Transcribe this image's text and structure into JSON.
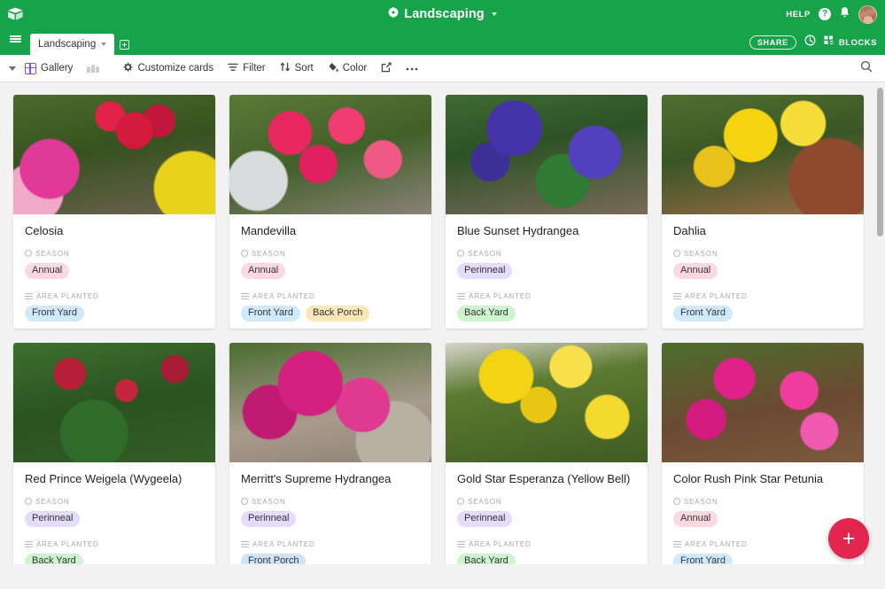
{
  "header": {
    "logo_icon": "airtable-cube-logo",
    "base_flower_icon": "flower-icon",
    "base_name": "Landscaping",
    "help_label": "HELP",
    "help_icon": "question-circle-icon",
    "notifications_icon": "bell-icon",
    "avatar_icon": "user-avatar"
  },
  "tabbar": {
    "menu_icon": "hamburger-menu-icon",
    "active_tab": "Landscaping",
    "add_tab_icon": "plus-box-icon",
    "share_label": "SHARE",
    "history_icon": "history-clock-icon",
    "blocks_icon": "blocks-icon",
    "blocks_label": "BLOCKS"
  },
  "toolbar": {
    "view_caret_icon": "caret-down-icon",
    "view_icon": "gallery-grid-icon",
    "view_name": "Gallery",
    "collaborators_icon": "collaborators-icon",
    "customize_icon": "gear-icon",
    "customize_label": "Customize cards",
    "filter_icon": "filter-icon",
    "filter_label": "Filter",
    "sort_icon": "sort-icon",
    "sort_label": "Sort",
    "color_icon": "paint-drop-icon",
    "color_label": "Color",
    "share_view_icon": "external-link-icon",
    "more_icon": "ellipsis-icon",
    "search_icon": "search-icon"
  },
  "fields": {
    "season_label": "SEASON",
    "season_icon": "single-select-icon",
    "area_label": "AREA PLANTED",
    "area_icon": "multi-select-icon"
  },
  "pill_colors": {
    "Annual": "#fcd9e2",
    "Perinneal": "#e3dcfb",
    "Front Yard": "#cfeafc",
    "Back Porch": "#fbe6b8",
    "Back Yard": "#cdf3cf",
    "Front Porch": "#cfe4fb"
  },
  "accent": {
    "green": "#16a34a",
    "fab": "#e2264d",
    "purple": "#7c4dff"
  },
  "fab": {
    "label": "+",
    "icon": "plus-icon"
  },
  "cards": [
    {
      "title": "Celosia",
      "season": [
        "Annual"
      ],
      "area": [
        "Front Yard"
      ],
      "image": "celosia-photo"
    },
    {
      "title": "Mandevilla",
      "season": [
        "Annual"
      ],
      "area": [
        "Front Yard",
        "Back Porch"
      ],
      "image": "mandevilla-photo"
    },
    {
      "title": "Blue Sunset Hydrangea",
      "season": [
        "Perinneal"
      ],
      "area": [
        "Back Yard"
      ],
      "image": "blue-sunset-hydrangea-photo"
    },
    {
      "title": "Dahlia",
      "season": [
        "Annual"
      ],
      "area": [
        "Front Yard"
      ],
      "image": "dahlia-photo"
    },
    {
      "title": "Red Prince Weigela (Wygeela)",
      "season": [
        "Perinneal"
      ],
      "area": [
        "Back Yard"
      ],
      "image": "red-prince-weigela-photo"
    },
    {
      "title": "Merritt's Supreme Hydrangea",
      "season": [
        "Perinneal"
      ],
      "area": [
        "Front Porch"
      ],
      "image": "merritts-supreme-hydrangea-photo"
    },
    {
      "title": "Gold Star Esperanza (Yellow Bell)",
      "season": [
        "Perinneal"
      ],
      "area": [
        "Back Yard"
      ],
      "image": "gold-star-esperanza-photo"
    },
    {
      "title": "Color Rush Pink Star Petunia",
      "season": [
        "Annual"
      ],
      "area": [
        "Front Yard"
      ],
      "image": "color-rush-pink-star-petunia-photo"
    }
  ]
}
